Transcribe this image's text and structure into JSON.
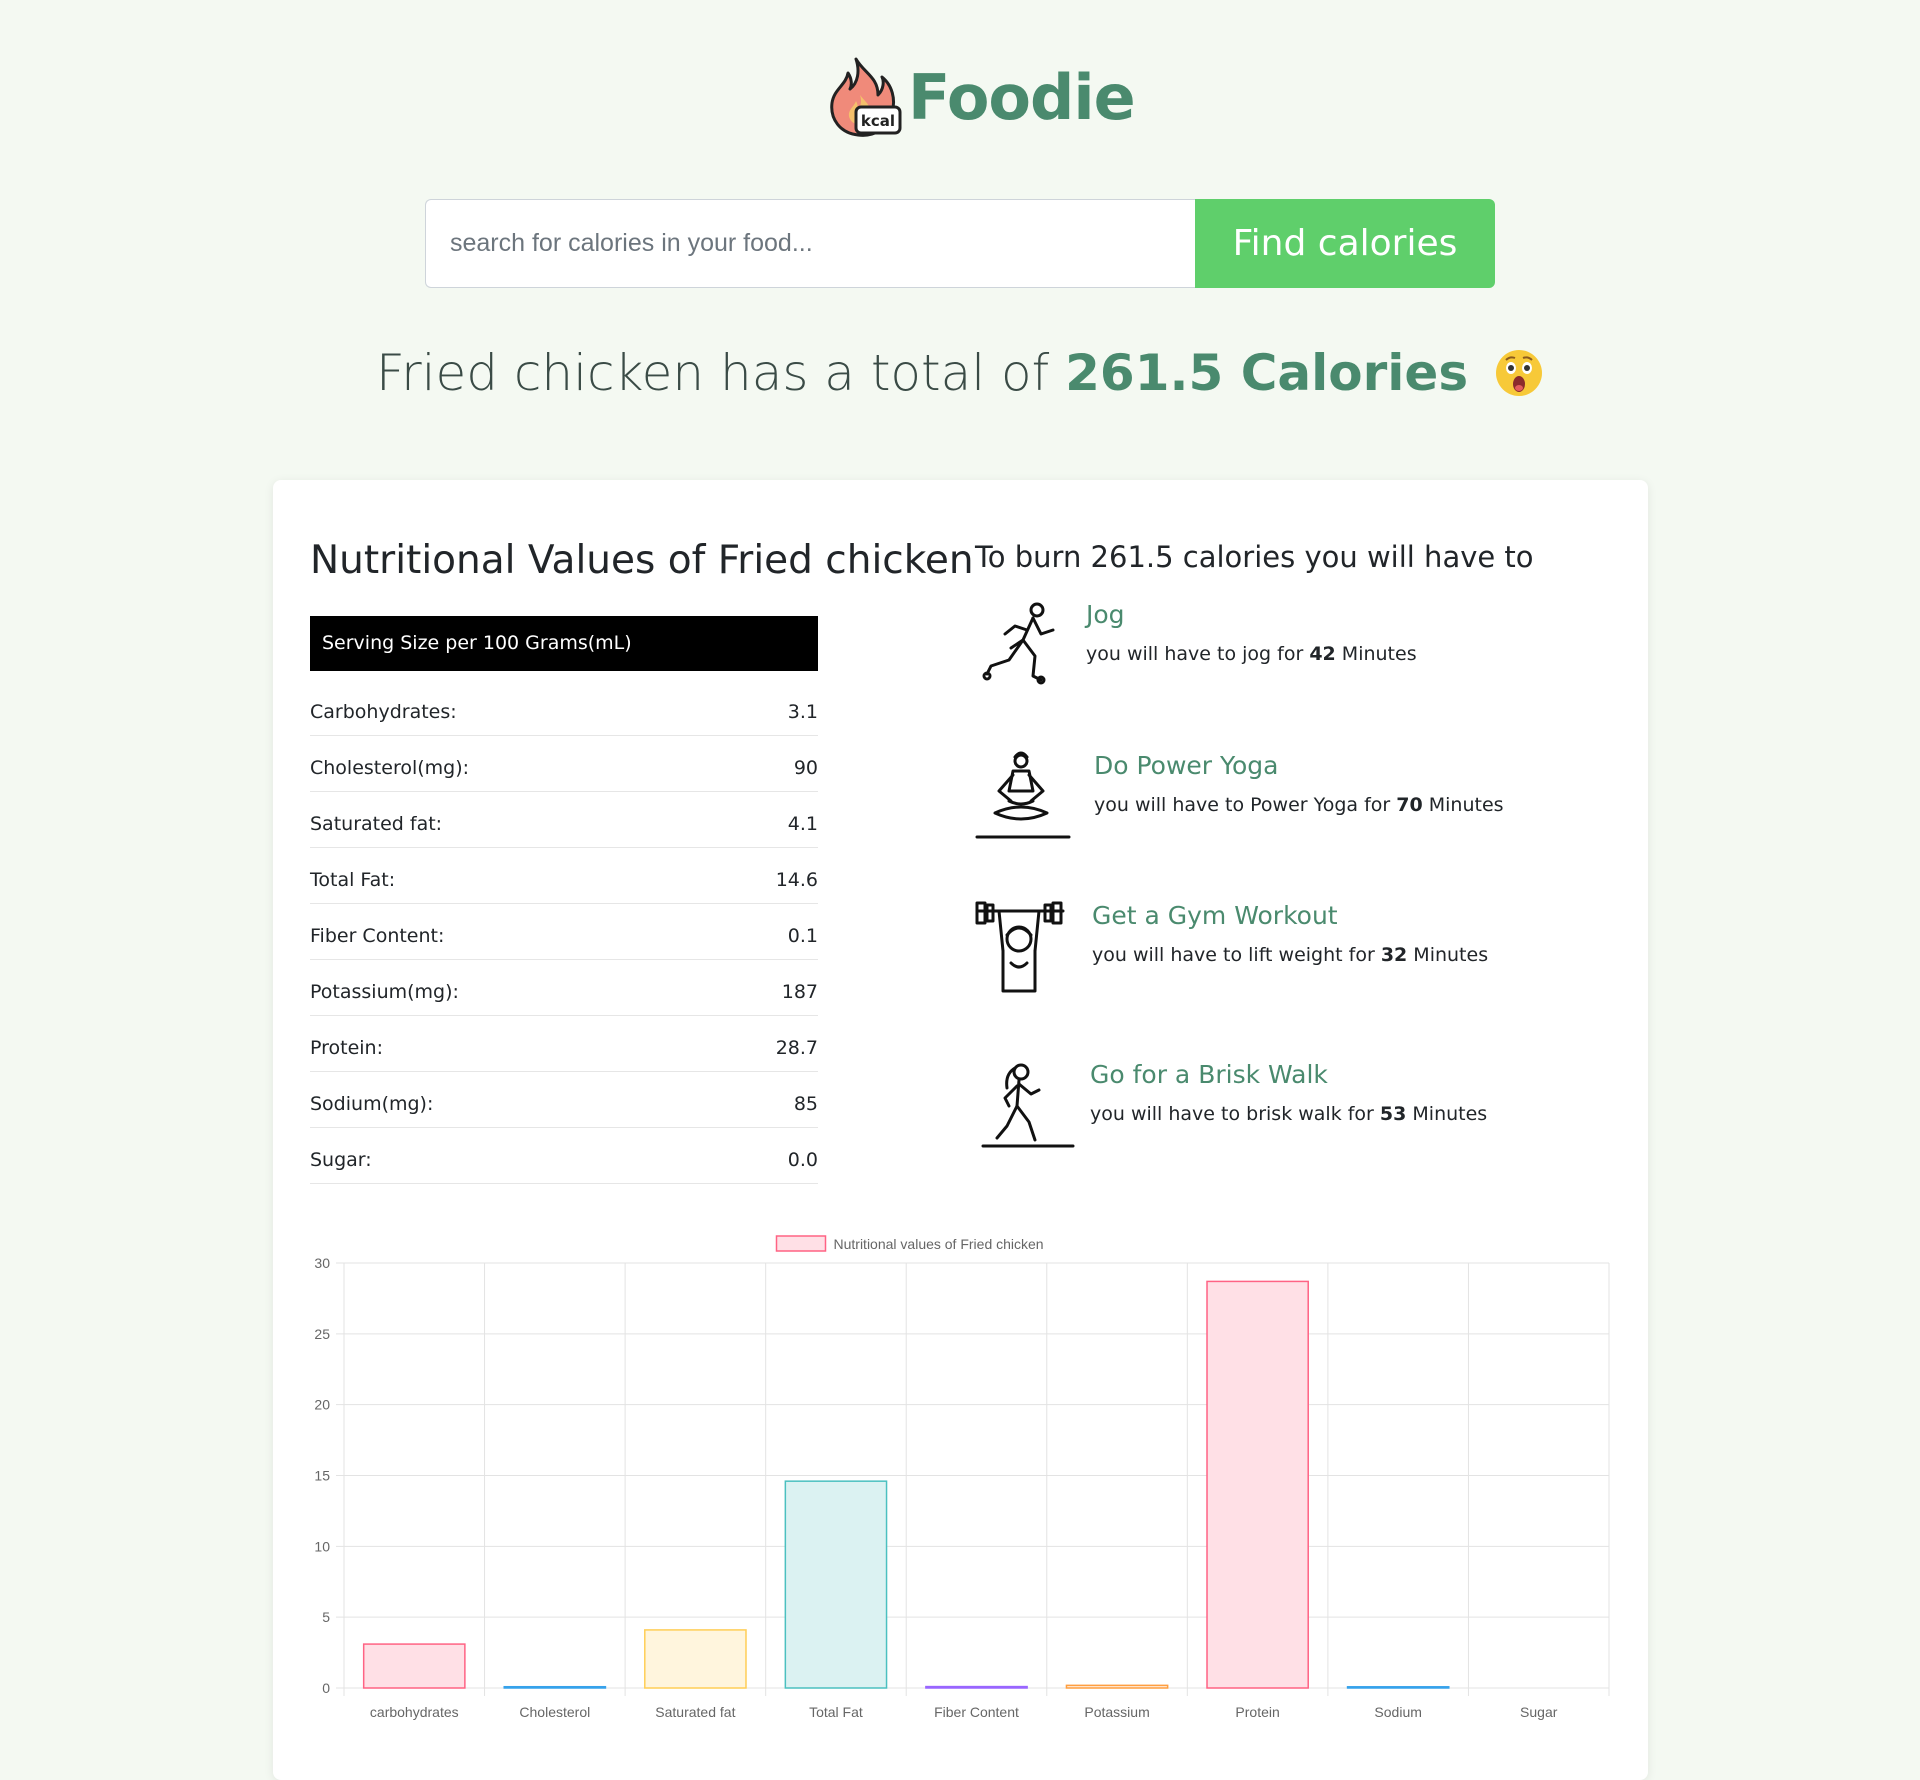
{
  "logo": {
    "badge": "kcal",
    "name": "Foodie"
  },
  "search": {
    "placeholder": "search for calories in your food...",
    "button": "Find calories"
  },
  "headline": {
    "prefix": "Fried chicken has a total of ",
    "calories": "261.5 Calories",
    "emoji": "astonished-face"
  },
  "nutrition": {
    "title": "Nutritional Values of Fried chicken",
    "serving": "Serving Size per 100 Grams(mL)",
    "rows": [
      {
        "label": "Carbohydrates:",
        "value": "3.1"
      },
      {
        "label": "Cholesterol(mg):",
        "value": "90"
      },
      {
        "label": "Saturated fat:",
        "value": "4.1"
      },
      {
        "label": "Total Fat:",
        "value": "14.6"
      },
      {
        "label": "Fiber Content:",
        "value": "0.1"
      },
      {
        "label": "Potassium(mg):",
        "value": "187"
      },
      {
        "label": "Protein:",
        "value": "28.7"
      },
      {
        "label": "Sodium(mg):",
        "value": "85"
      },
      {
        "label": "Sugar:",
        "value": "0.0"
      }
    ]
  },
  "burn": {
    "title": "To burn 261.5 calories you will have to",
    "items": [
      {
        "name": "Jog",
        "desc_prefix": "you will have to jog for ",
        "minutes": "42",
        "desc_suffix": " Minutes",
        "icon": "jogging-icon"
      },
      {
        "name": "Do Power Yoga",
        "desc_prefix": "you will have to Power Yoga for ",
        "minutes": "70",
        "desc_suffix": " Minutes",
        "icon": "yoga-icon"
      },
      {
        "name": "Get a Gym Workout",
        "desc_prefix": "you will have to lift weight for ",
        "minutes": "32",
        "desc_suffix": " Minutes",
        "icon": "weightlifting-icon"
      },
      {
        "name": "Go for a Brisk Walk",
        "desc_prefix": "you will have to brisk walk for ",
        "minutes": "53",
        "desc_suffix": " Minutes",
        "icon": "walking-icon"
      }
    ]
  },
  "colors": {
    "accent": "#4a8a6e",
    "button": "#5fcf6b",
    "background": "#f4f9f2"
  },
  "chart_data": {
    "type": "bar",
    "legend": "Nutritional values of Fried chicken",
    "legend_position": "top",
    "categories": [
      "carbohydrates",
      "Cholesterol",
      "Saturated fat",
      "Total Fat",
      "Fiber Content",
      "Potassium",
      "Protein",
      "Sodium",
      "Sugar"
    ],
    "values": [
      3.1,
      0.09,
      4.1,
      14.6,
      0.1,
      0.187,
      28.7,
      0.085,
      0.0
    ],
    "ylim": [
      0,
      30
    ],
    "yticks": [
      0,
      5,
      10,
      15,
      20,
      25,
      30
    ],
    "grid": true,
    "colors": [
      {
        "fill": "#ffe0e6",
        "stroke": "#ff6384"
      },
      {
        "fill": "#d7ecfb",
        "stroke": "#36a2eb"
      },
      {
        "fill": "#fff5dd",
        "stroke": "#ffce56"
      },
      {
        "fill": "#dbf2f2",
        "stroke": "#4bc0c0"
      },
      {
        "fill": "#ebe0ff",
        "stroke": "#9966ff"
      },
      {
        "fill": "#ffecd9",
        "stroke": "#ff9f40"
      },
      {
        "fill": "#ffe0e6",
        "stroke": "#ff6384"
      },
      {
        "fill": "#d7ecfb",
        "stroke": "#36a2eb"
      },
      {
        "fill": "#fff5dd",
        "stroke": "#ffce56"
      }
    ]
  }
}
